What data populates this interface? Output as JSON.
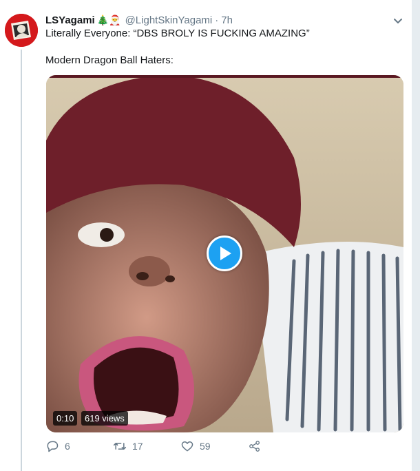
{
  "tweet": {
    "display_name": "LSYagami",
    "emoji_decor": "🎄🎅",
    "handle": "@LightSkinYagami",
    "separator": "·",
    "time": "7h",
    "text_line1": "Literally Everyone: “DBS BROLY IS FUCKING AMAZING”",
    "text_line2": "Modern Dragon Ball Haters:"
  },
  "video": {
    "duration": "0:10",
    "views": "619 views"
  },
  "actions": {
    "reply_count": "6",
    "retweet_count": "17",
    "like_count": "59"
  },
  "colors": {
    "accent": "#1da1f2",
    "muted": "#657786",
    "avatar_bg": "#d4191c",
    "thread_line": "#ccd6dd"
  },
  "icons": [
    "caret-down-icon",
    "play-icon",
    "reply-icon",
    "retweet-icon",
    "like-icon",
    "share-icon"
  ]
}
